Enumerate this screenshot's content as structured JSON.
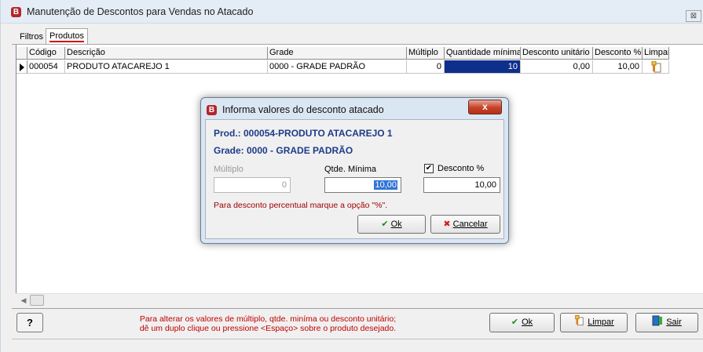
{
  "window": {
    "title": "Manutenção de Descontos para Vendas no Atacado",
    "app_icon": "B",
    "close_glyph": "⊠"
  },
  "tabs": [
    {
      "label": "Filtros"
    },
    {
      "label": "Produtos"
    }
  ],
  "grid": {
    "columns": [
      "Código",
      "Descrição",
      "Grade",
      "Múltiplo",
      "Quantidade mínima",
      "Desconto unitário",
      "Desconto %",
      "Limpar"
    ],
    "rows": [
      {
        "codigo": "000054",
        "descricao": "PRODUTO ATACAREJO 1",
        "grade": "0000 - GRADE PADRÃO",
        "multiplo": "0",
        "qtd_minima": "10",
        "desc_unitario": "0,00",
        "desc_pct": "10,00"
      }
    ]
  },
  "footer": {
    "help_label": "?",
    "hint_line1": "Para alterar os valores de  múltiplo, qtde. miníma ou desconto unitário;",
    "hint_line2": "dê um duplo clique ou pressione <Espaço> sobre o produto desejado.",
    "ok_label": "Ok",
    "limpar_label": "Limpar",
    "sair_label": "Sair"
  },
  "dialog": {
    "title": "Informa valores do desconto atacado",
    "close_glyph": "x",
    "product": "Prod.: 000054-PRODUTO ATACAREJO 1",
    "grade": "Grade: 0000 - GRADE PADRÃO",
    "multiplo_label": "Múltiplo",
    "multiplo_value": "0",
    "qtde_label": "Qtde. Mínima",
    "qtde_value": "10,00",
    "desconto_label": "Desconto %",
    "desconto_checked": true,
    "desconto_value": "10,00",
    "hint": "Para desconto percentual marque a opção \"%\".",
    "ok_label": "Ok",
    "cancel_label": "Cancelar"
  },
  "colors": {
    "selection": "#0f2f8c",
    "hint_red": "#c00000",
    "dialog_heading": "#1e3b8a",
    "brand_icon": "#b3272b"
  }
}
